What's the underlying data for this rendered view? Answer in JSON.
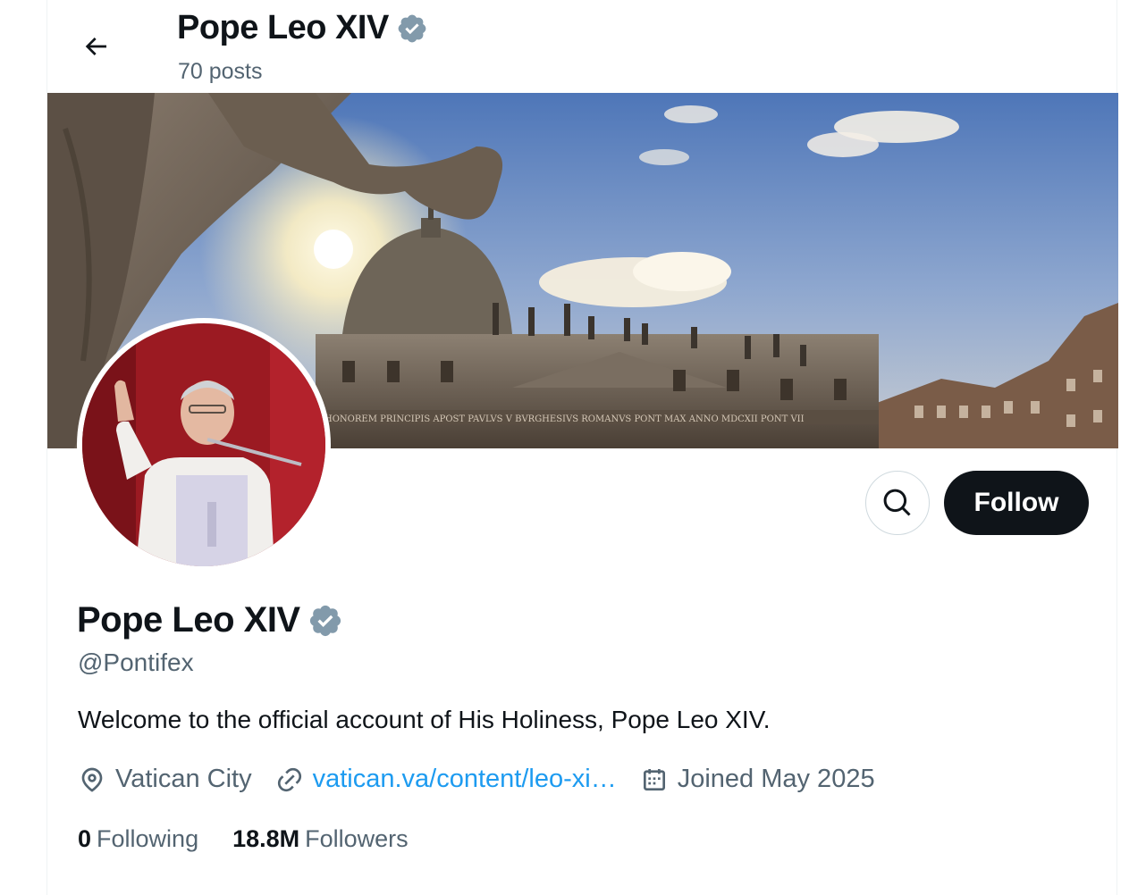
{
  "header": {
    "title": "Pope Leo XIV",
    "post_count": "70 posts"
  },
  "profile": {
    "name": "Pope Leo XIV",
    "handle": "@Pontifex",
    "bio": "Welcome to the official account of His Holiness, Pope Leo XIV.",
    "location": "Vatican City",
    "website": "vatican.va/content/leo-xi…",
    "joined": "Joined May 2025",
    "following_count": "0",
    "following_label": "Following",
    "followers_count": "18.8M",
    "followers_label": "Followers",
    "verified": true
  },
  "actions": {
    "follow_label": "Follow"
  },
  "banner": {
    "inscription": "HONOREM PRINCIPIS APOST PAVLVS V BVRGHESIVS ROMANVS PONT MAX ANNO MDCXII PONT VII"
  },
  "colors": {
    "text_primary": "#0f1419",
    "text_secondary": "#536471",
    "link": "#1d9bf0",
    "verified_badge": "#829aab",
    "follow_bg": "#0f1419"
  },
  "icons": {
    "back": "arrow-left-icon",
    "verified": "verified-badge-icon",
    "search": "search-icon",
    "location": "location-pin-icon",
    "link": "link-icon",
    "calendar": "calendar-icon"
  }
}
